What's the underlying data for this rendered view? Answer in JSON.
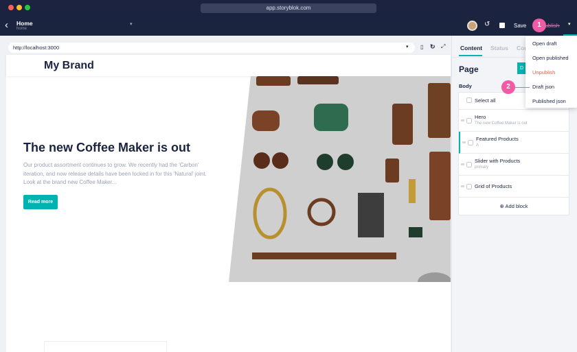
{
  "browser": {
    "address": "app.storyblok.com"
  },
  "header": {
    "title": "Home",
    "subtitle": "home",
    "save_label": "Save",
    "publish_label": "Publish"
  },
  "preview": {
    "url": "http://localhost:3000",
    "brand": "My Brand",
    "hero_title": "The new Coffee Maker is out",
    "hero_text": "Our product assortment continues to grow. We recently had the 'Carbon' iteration, and now release details have been locked in for this 'Natural' joint. Look at the brand new Coffee Maker...",
    "read_more": "Read more"
  },
  "panel": {
    "tabs": [
      "Content",
      "Status",
      "Config"
    ],
    "page_title": "Page",
    "page_button": "D",
    "body_label": "Body",
    "select_all": "Select all",
    "blocks": [
      {
        "title": "Hero",
        "subtitle": "The new Coffee Maker is out"
      },
      {
        "title": "Featured Products",
        "subtitle": "A"
      },
      {
        "title": "Slider with Products",
        "subtitle": "primary"
      },
      {
        "title": "Grid of Products",
        "subtitle": ""
      }
    ],
    "add_block": "Add block"
  },
  "menu": {
    "items": [
      "Open draft",
      "Open published",
      "Unpublish",
      "Draft json",
      "Published json"
    ]
  },
  "annotations": [
    "1",
    "2"
  ],
  "colors": {
    "accent": "#00b3b0",
    "danger": "#e85d4a",
    "badge": "#f15ba6",
    "navy": "#1b243f"
  }
}
